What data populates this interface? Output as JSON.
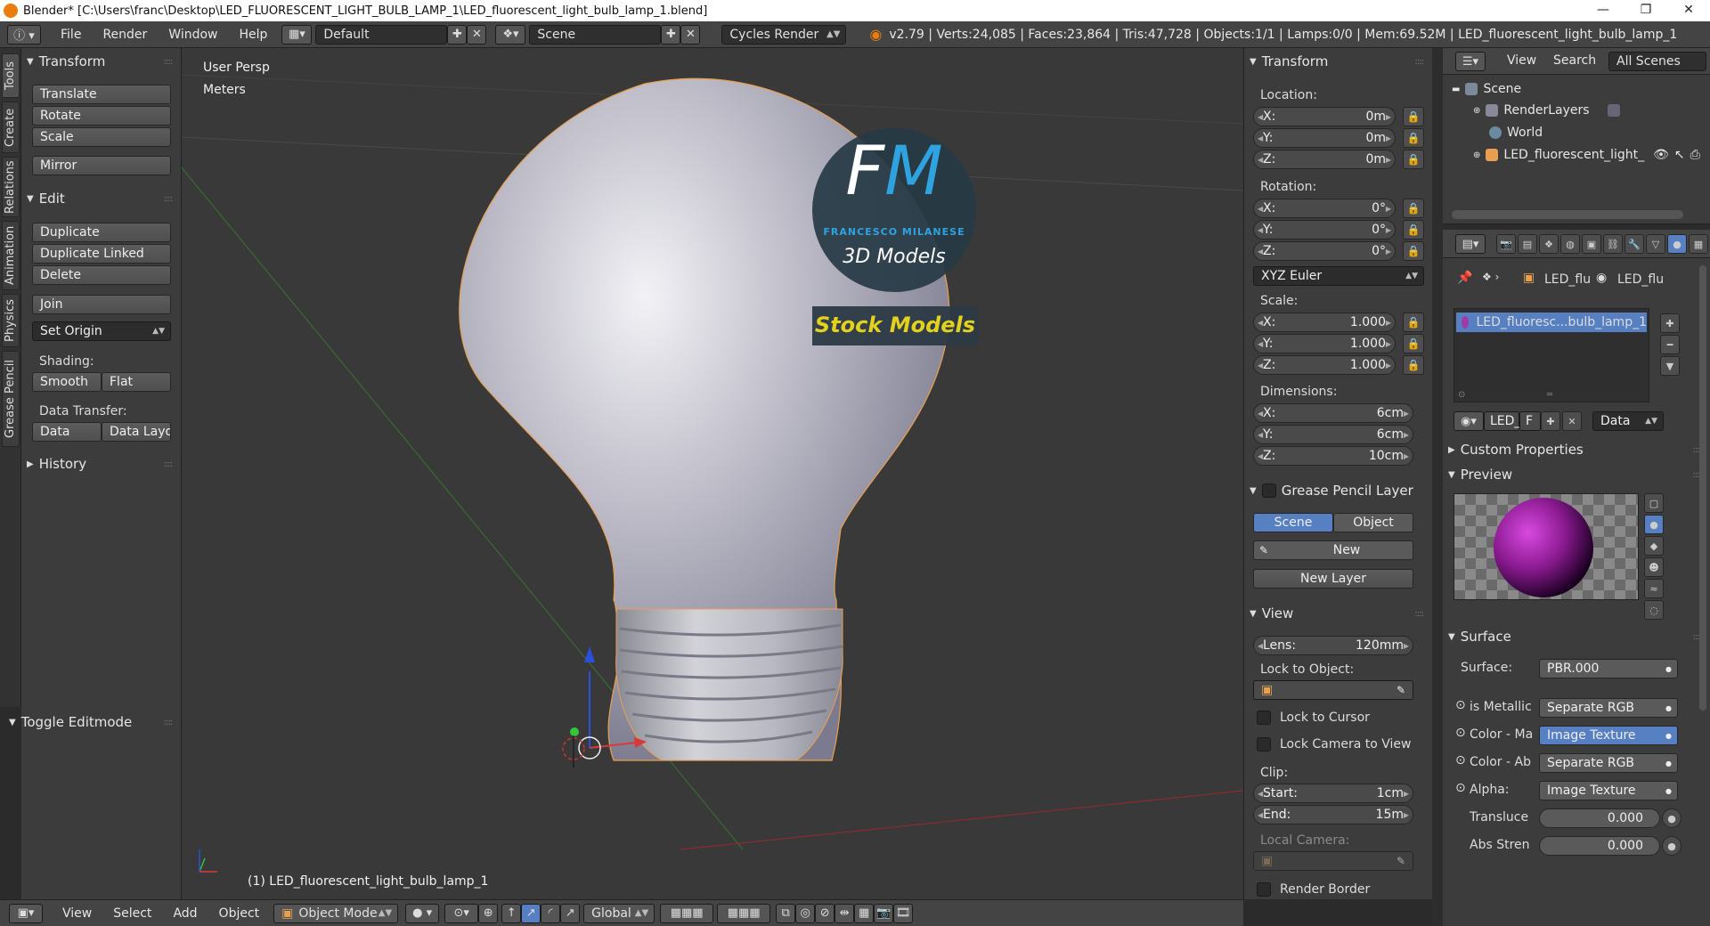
{
  "window": {
    "title": "Blender* [C:\\Users\\franc\\Desktop\\LED_FLUORESCENT_LIGHT_BULB_LAMP_1\\LED_fluorescent_light_bulb_lamp_1.blend]",
    "minimize": "—",
    "maximize": "❐",
    "close": "✕"
  },
  "menu": {
    "items": [
      "File",
      "Render",
      "Window",
      "Help"
    ],
    "layout": "Default",
    "scene": "Scene",
    "engine": "Cycles Render",
    "stats": "v2.79 | Verts:24,085 | Faces:23,864 | Tris:47,728 | Objects:1/1 | Lamps:0/0 | Mem:69.52M | LED_fluorescent_light_bulb_lamp_1"
  },
  "tabs": [
    "Tools",
    "Create",
    "Relations",
    "Animation",
    "Physics",
    "Grease Pencil"
  ],
  "tools": {
    "transform_title": "Transform",
    "translate": "Translate",
    "rotate": "Rotate",
    "scale": "Scale",
    "mirror": "Mirror",
    "edit_title": "Edit",
    "duplicate": "Duplicate",
    "duplicate_linked": "Duplicate Linked",
    "delete": "Delete",
    "join": "Join",
    "set_origin": "Set Origin",
    "shading_label": "Shading:",
    "smooth": "Smooth",
    "flat": "Flat",
    "data_transfer_label": "Data Transfer:",
    "data": "Data",
    "data_layo": "Data Layo",
    "history_title": "History",
    "toggle_editmode": "Toggle Editmode"
  },
  "viewport": {
    "persp": "User Persp",
    "units": "Meters",
    "object_label": "(1) LED_fluorescent_light_bulb_lamp_1",
    "logo_fm": "FM",
    "logo_name": "FRANCESCO MILANESE",
    "logo_sub": "3D Models",
    "stock": "Stock Models"
  },
  "npanel": {
    "transform_title": "Transform",
    "location_label": "Location:",
    "loc": [
      {
        "k": "X:",
        "v": "0m"
      },
      {
        "k": "Y:",
        "v": "0m"
      },
      {
        "k": "Z:",
        "v": "0m"
      }
    ],
    "rotation_label": "Rotation:",
    "rot": [
      {
        "k": "X:",
        "v": "0°"
      },
      {
        "k": "Y:",
        "v": "0°"
      },
      {
        "k": "Z:",
        "v": "0°"
      }
    ],
    "rot_mode": "XYZ Euler",
    "scale_label": "Scale:",
    "scale": [
      {
        "k": "X:",
        "v": "1.000"
      },
      {
        "k": "Y:",
        "v": "1.000"
      },
      {
        "k": "Z:",
        "v": "1.000"
      }
    ],
    "dimensions_label": "Dimensions:",
    "dims": [
      {
        "k": "X:",
        "v": "6cm"
      },
      {
        "k": "Y:",
        "v": "6cm"
      },
      {
        "k": "Z:",
        "v": "10cm"
      }
    ],
    "grease_title": "Grease Pencil Layer",
    "gp_scene": "Scene",
    "gp_object": "Object",
    "gp_new": "New",
    "gp_new_layer": "New Layer",
    "view_title": "View",
    "lens_k": "Lens:",
    "lens_v": "120mm",
    "lock_obj": "Lock to Object:",
    "lock_cursor": "Lock to Cursor",
    "lock_camera": "Lock Camera to View",
    "clip_label": "Clip:",
    "clip_start_k": "Start:",
    "clip_start_v": "1cm",
    "clip_end_k": "End:",
    "clip_end_v": "15m",
    "local_camera": "Local Camera:",
    "render_border": "Render Border"
  },
  "outliner": {
    "view": "View",
    "search": "Search",
    "all_scenes": "All Scenes",
    "scene": "Scene",
    "renderlayers": "RenderLayers",
    "world": "World",
    "object": "LED_fluorescent_light_"
  },
  "properties": {
    "crumb1": "LED_flu",
    "crumb2": "LED_flu",
    "material_slot": "LED_fluoresc...bulb_lamp_1",
    "mat_name": "LED_f",
    "mat_f": "F",
    "mat_link": "Data",
    "custom_props": "Custom Properties",
    "preview": "Preview",
    "surface_title": "Surface",
    "surface_k": "Surface:",
    "surface_v": "PBR.000",
    "rows": [
      {
        "k": "is Metallic",
        "v": "Separate RGB"
      },
      {
        "k": "Color - Ma",
        "v": "Image Texture"
      },
      {
        "k": "Color - Ab",
        "v": "Separate RGB"
      },
      {
        "k": "Alpha:",
        "v": "Image Texture"
      }
    ],
    "transluce_k": "Transluce",
    "transluce_v": "0.000",
    "absstren_k": "Abs Stren",
    "absstren_v": "0.000"
  },
  "bottom": {
    "view": "View",
    "select": "Select",
    "add": "Add",
    "object": "Object",
    "mode": "Object Mode",
    "orientation": "Global"
  },
  "colors": {
    "accent": "#5680c2",
    "logo_blue": "#2fa3e0",
    "stock_yellow": "#e3d11d",
    "selection_orange": "#e8a050"
  }
}
